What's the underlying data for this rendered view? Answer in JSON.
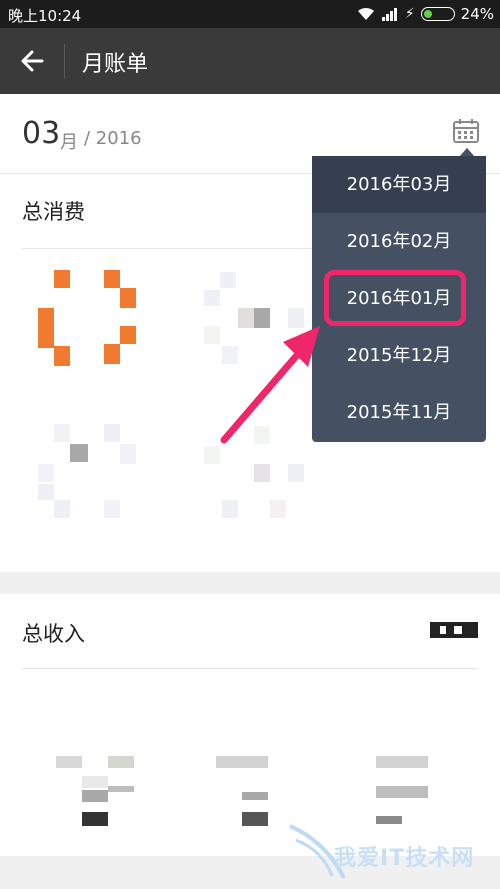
{
  "status_bar": {
    "time": "晚上10:24",
    "battery": "24%"
  },
  "header": {
    "title": "月账单"
  },
  "month_selector": {
    "month": "03",
    "unit": "月",
    "year": "/ 2016"
  },
  "sections": {
    "expense_title": "总消费",
    "income_title": "总收入"
  },
  "dropdown": {
    "items": [
      {
        "label": "2016年03月",
        "selected": true
      },
      {
        "label": "2016年02月",
        "selected": false
      },
      {
        "label": "2016年01月",
        "selected": false,
        "highlighted": true
      },
      {
        "label": "2015年12月",
        "selected": false
      },
      {
        "label": "2015年11月",
        "selected": false
      }
    ]
  },
  "watermark": {
    "text": "我爱IT技术网"
  },
  "colors": {
    "accent_orange": "#f07a30",
    "highlight_pink": "#f0266a",
    "dropdown_bg": "#455062"
  }
}
